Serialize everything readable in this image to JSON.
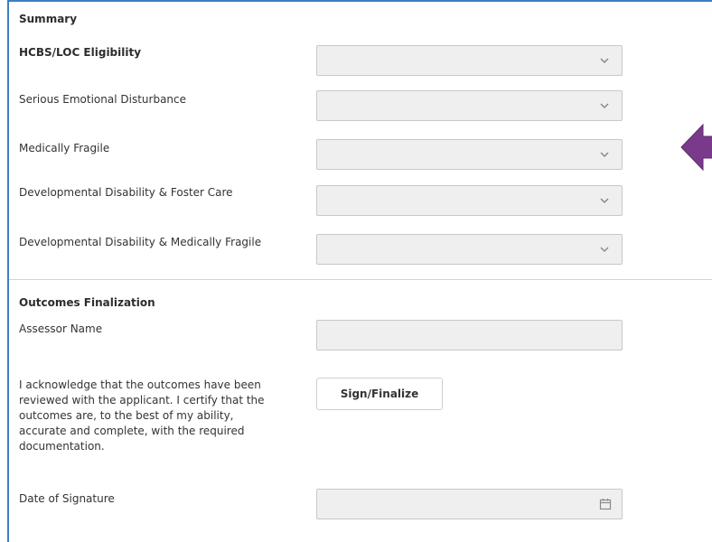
{
  "summary": {
    "heading": "Summary",
    "eligibility_heading": "HCBS/LOC Eligibility",
    "rows": [
      {
        "label": "Serious Emotional Disturbance"
      },
      {
        "label": "Medically Fragile"
      },
      {
        "label": "Developmental Disability & Foster Care"
      },
      {
        "label": "Developmental Disability & Medically Fragile"
      }
    ]
  },
  "outcomes": {
    "heading": "Outcomes Finalization",
    "assessor_label": "Assessor Name",
    "assessor_value": "",
    "acknowledge_text": "I acknowledge that the outcomes have been reviewed with the applicant. I certify that the outcomes are, to the best of my ability, accurate and complete, with the required documentation.",
    "sign_button": "Sign/Finalize",
    "date_label": "Date of Signature",
    "date_value": ""
  },
  "icons": {
    "select_chevron": "chevron-down-icon",
    "calendar": "calendar-icon",
    "callout_arrow": "arrow-left-icon"
  },
  "colors": {
    "panel_border": "#3b7fc4",
    "field_background": "#efefef",
    "arrow": "#7a3a8c"
  }
}
